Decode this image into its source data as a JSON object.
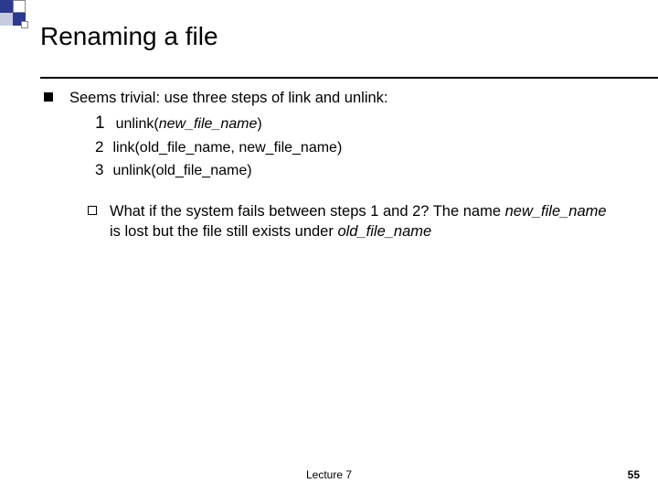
{
  "title": "Renaming a file",
  "main_bullet": "Seems trivial: use three steps of link and unlink:",
  "steps": {
    "s1_num": "1",
    "s1_text_pre": "unlink(",
    "s1_text_em": "new_file_name",
    "s1_text_post": ")",
    "s2_num": "2",
    "s2_text": "link(old_file_name, new_file_name)",
    "s3_num": "3",
    "s3_text": "unlink(old_file_name)"
  },
  "sub": {
    "pre": "What if  the system fails between steps 1 and 2? The name ",
    "em1": "new_file_name",
    "mid": " is lost but the file still exists under ",
    "em2": "old_file_name"
  },
  "footer": {
    "center": "Lecture 7",
    "right": "55"
  }
}
